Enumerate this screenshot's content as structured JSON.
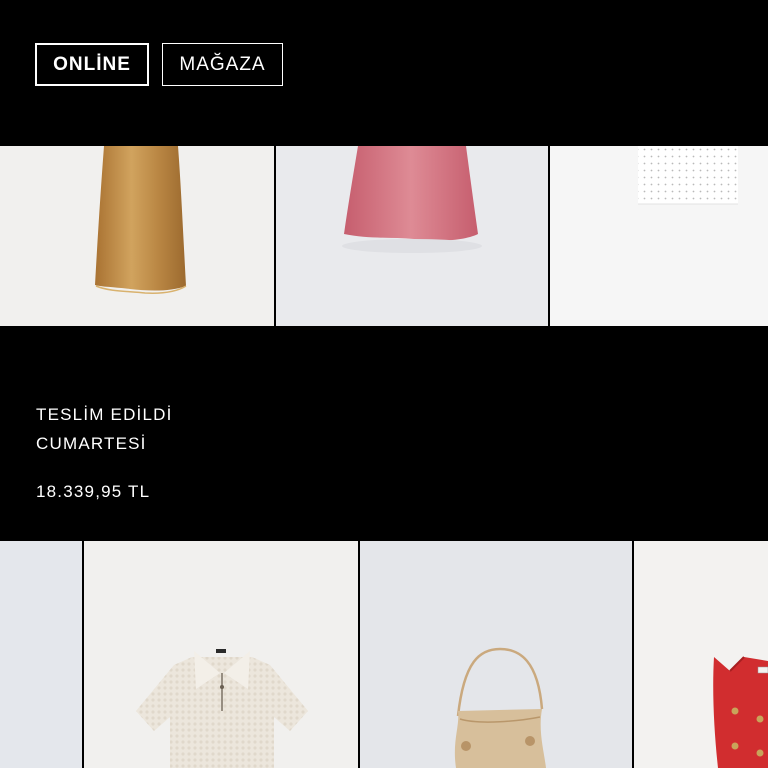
{
  "order_tabs": {
    "online_label": "ONLİNE",
    "store_label": "MAĞAZA"
  },
  "order": {
    "status": "TESLİM EDİLDİ",
    "day": "CUMARTESİ",
    "total": "18.339,95 TL"
  },
  "products_top": [
    {
      "name": "gold-satin-skirt",
      "color": "#b9853f"
    },
    {
      "name": "pink-satin-skirt",
      "color": "#d47884"
    },
    {
      "name": "white-eyelet-top",
      "color": "#f5f5f5"
    }
  ],
  "products_bottom": [
    {
      "name": "partial-grey-item",
      "color": "#e6e8ec"
    },
    {
      "name": "cream-knit-polo",
      "color": "#ece5da"
    },
    {
      "name": "beige-shoulder-bag",
      "color": "#cbb08f"
    },
    {
      "name": "red-knit-vest",
      "color": "#cc2a2c"
    }
  ]
}
